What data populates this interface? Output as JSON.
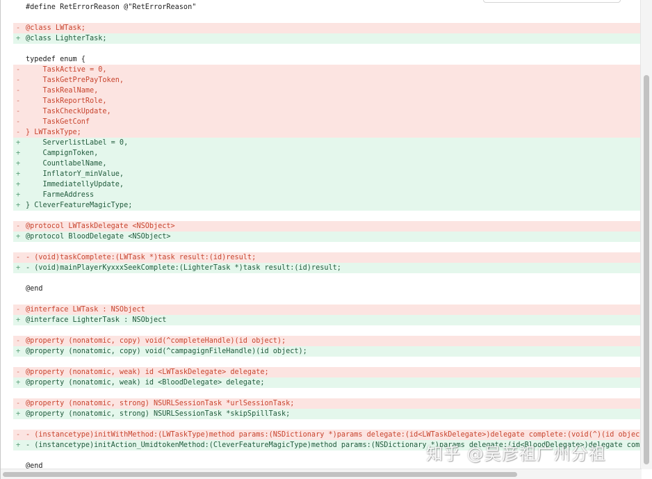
{
  "diff_lines": [
    {
      "kind": "ctx",
      "marker": "",
      "text": "#define RetErrorReason @\"RetErrorReason\""
    },
    {
      "kind": "ctx",
      "marker": "",
      "text": ""
    },
    {
      "kind": "del",
      "marker": "-",
      "text": "@class LWTask;"
    },
    {
      "kind": "add",
      "marker": "+",
      "text": "@class LighterTask;"
    },
    {
      "kind": "ctx",
      "marker": "",
      "text": ""
    },
    {
      "kind": "ctx",
      "marker": "",
      "text": "typedef enum {"
    },
    {
      "kind": "del",
      "marker": "-",
      "text": "    TaskActive = 0,"
    },
    {
      "kind": "del",
      "marker": "-",
      "text": "    TaskGetPrePayToken,"
    },
    {
      "kind": "del",
      "marker": "-",
      "text": "    TaskRealName,"
    },
    {
      "kind": "del",
      "marker": "-",
      "text": "    TaskReportRole,"
    },
    {
      "kind": "del",
      "marker": "-",
      "text": "    TaskCheckUpdate,"
    },
    {
      "kind": "del",
      "marker": "-",
      "text": "    TaskGetConf"
    },
    {
      "kind": "del",
      "marker": "-",
      "text": "} LWTaskType;"
    },
    {
      "kind": "add",
      "marker": "+",
      "text": "    ServerlistLabel = 0,"
    },
    {
      "kind": "add",
      "marker": "+",
      "text": "    CampignToken,"
    },
    {
      "kind": "add",
      "marker": "+",
      "text": "    CountlabelName,"
    },
    {
      "kind": "add",
      "marker": "+",
      "text": "    InflatorY_minValue,"
    },
    {
      "kind": "add",
      "marker": "+",
      "text": "    ImmediatellyUpdate,"
    },
    {
      "kind": "add",
      "marker": "+",
      "text": "    FarmeAddress"
    },
    {
      "kind": "add",
      "marker": "+",
      "text": "} CleverFeatureMagicType;"
    },
    {
      "kind": "ctx",
      "marker": "",
      "text": ""
    },
    {
      "kind": "del",
      "marker": "-",
      "text": "@protocol LWTaskDelegate <NSObject>"
    },
    {
      "kind": "add",
      "marker": "+",
      "text": "@protocol BloodDelegate <NSObject>"
    },
    {
      "kind": "ctx",
      "marker": "",
      "text": ""
    },
    {
      "kind": "del",
      "marker": "-",
      "text": "- (void)taskComplete:(LWTask *)task result:(id)result;"
    },
    {
      "kind": "add",
      "marker": "+",
      "text": "- (void)mainPlayerKyxxxSeekComplete:(LighterTask *)task result:(id)result;"
    },
    {
      "kind": "ctx",
      "marker": "",
      "text": ""
    },
    {
      "kind": "ctx",
      "marker": "",
      "text": "@end"
    },
    {
      "kind": "ctx",
      "marker": "",
      "text": ""
    },
    {
      "kind": "del",
      "marker": "-",
      "text": "@interface LWTask : NSObject"
    },
    {
      "kind": "add",
      "marker": "+",
      "text": "@interface LighterTask : NSObject"
    },
    {
      "kind": "ctx",
      "marker": "",
      "text": ""
    },
    {
      "kind": "del",
      "marker": "-",
      "text": "@property (nonatomic, copy) void(^completeHandle)(id object);"
    },
    {
      "kind": "add",
      "marker": "+",
      "text": "@property (nonatomic, copy) void(^campagignFileHandle)(id object);"
    },
    {
      "kind": "ctx",
      "marker": "",
      "text": ""
    },
    {
      "kind": "del",
      "marker": "-",
      "text": "@property (nonatomic, weak) id <LWTaskDelegate> delegate;"
    },
    {
      "kind": "add",
      "marker": "+",
      "text": "@property (nonatomic, weak) id <BloodDelegate> delegate;"
    },
    {
      "kind": "ctx",
      "marker": "",
      "text": ""
    },
    {
      "kind": "del",
      "marker": "-",
      "text": "@property (nonatomic, strong) NSURLSessionTask *urlSessionTask;"
    },
    {
      "kind": "add",
      "marker": "+",
      "text": "@property (nonatomic, strong) NSURLSessionTask *skipSpillTask;"
    },
    {
      "kind": "ctx",
      "marker": "",
      "text": ""
    },
    {
      "kind": "del",
      "marker": "-",
      "text": "- (instancetype)initWithMethod:(LWTaskType)method params:(NSDictionary *)params delegate:(id<LWTaskDelegate>)delegate complete:(void(^)(id object))"
    },
    {
      "kind": "add",
      "marker": "+",
      "text": "- (instancetype)initAction_UmidtokenMethod:(CleverFeatureMagicType)method params:(NSDictionary *)params delegate:(id<BloodDelegate>)delegate comple"
    },
    {
      "kind": "ctx",
      "marker": "",
      "text": ""
    },
    {
      "kind": "ctx",
      "marker": "",
      "text": "@end"
    }
  ],
  "watermark": "知乎 @吴彦祖广州分祖",
  "colors": {
    "deleted_bg": "#fce4e1",
    "deleted_text": "#c8442e",
    "added_bg": "#e4f7ec",
    "added_text": "#1f5a3b"
  }
}
